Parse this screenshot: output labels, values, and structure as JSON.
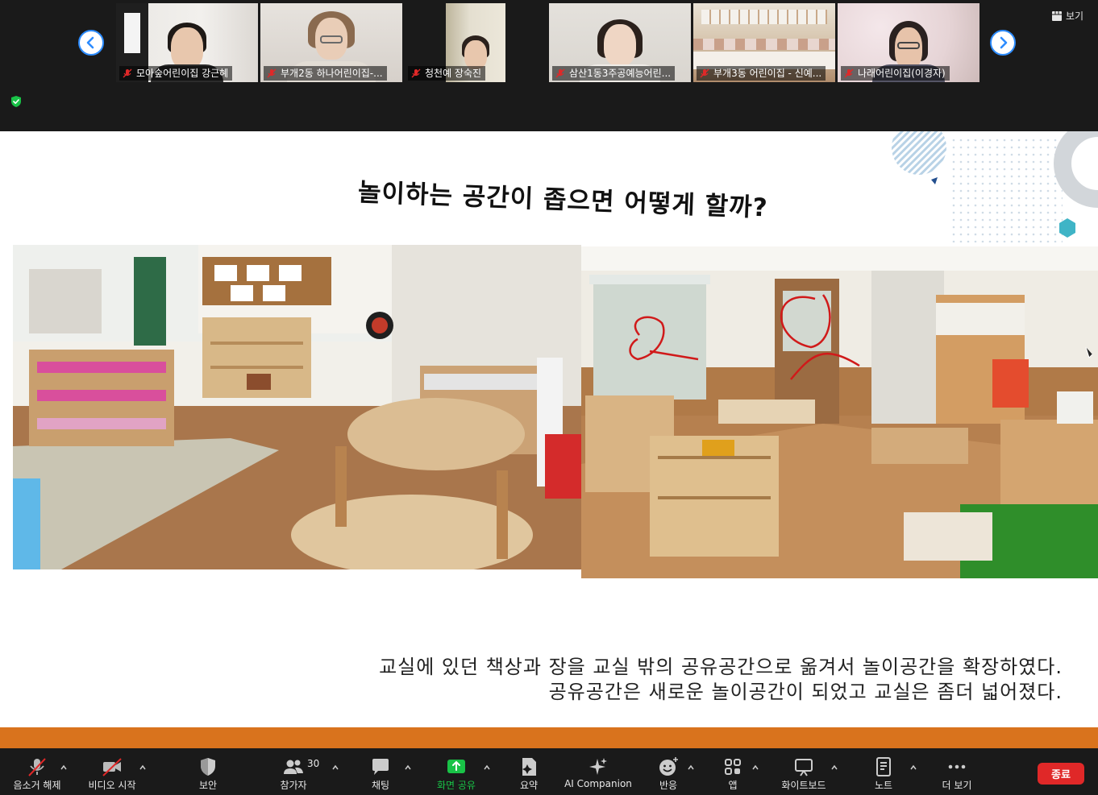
{
  "meeting": {
    "view_label": "보기",
    "participants": [
      {
        "name": "모아숲어린이집 강근혜"
      },
      {
        "name": "부개2동 하나어린이집-..."
      },
      {
        "name": "청천예 장숙진"
      },
      {
        "name": "삼산1동3주공예능어린..."
      },
      {
        "name": "부개3동 어린이집 - 신예..."
      },
      {
        "name": "나래어린이집(이경자)"
      }
    ]
  },
  "slide": {
    "title": "놀이하는 공간이 좁으면 어떻게 할까?",
    "caption_line1": "교실에 있던 책상과 장을 교실 밖의  공유공간으로 옮겨서 놀이공간을 확장하였다.",
    "caption_line2": "공유공간은 새로운 놀이공간이 되었고 교실은 좀더 넓어졌다."
  },
  "toolbar": {
    "mute": {
      "label": "음소거 해제",
      "icon": "muted-mic-icon"
    },
    "video": {
      "label": "비디오 시작",
      "icon": "video-off-icon"
    },
    "security": {
      "label": "보안",
      "icon": "shield-icon"
    },
    "participants": {
      "label": "참가자",
      "count": "30",
      "icon": "people-icon"
    },
    "chat": {
      "label": "채팅",
      "icon": "chat-icon"
    },
    "share": {
      "label": "화면 공유",
      "icon": "share-screen-icon"
    },
    "summary": {
      "label": "요약",
      "icon": "summary-icon"
    },
    "ai_companion": {
      "label": "AI Companion",
      "icon": "sparkle-icon"
    },
    "reactions": {
      "label": "반응",
      "icon": "emoji-icon"
    },
    "apps": {
      "label": "앱",
      "icon": "apps-icon"
    },
    "whiteboard": {
      "label": "화이트보드",
      "icon": "whiteboard-icon"
    },
    "notes": {
      "label": "노트",
      "icon": "notes-icon"
    },
    "more": {
      "label": "더 보기",
      "icon": "more-icon"
    },
    "end": {
      "label": "종료"
    }
  },
  "colors": {
    "background": "#1a1a1a",
    "accent_blue": "#2d8cff",
    "share_green": "#19c247",
    "end_red": "#e02828",
    "band_orange": "#d9731d"
  }
}
